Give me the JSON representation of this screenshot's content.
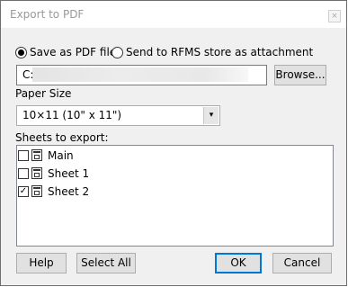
{
  "window": {
    "title": "Export to PDF",
    "close_glyph": "×"
  },
  "export_mode": {
    "options": [
      {
        "label": "Save as PDF file",
        "selected": true
      },
      {
        "label": "Send to RFMS store as attachment",
        "selected": false
      }
    ]
  },
  "path": {
    "value": "C:\\"
  },
  "browse_button": {
    "label": "Browse..."
  },
  "paper_size": {
    "label": "Paper Size",
    "selected": "10×11 (10\" x 11\")",
    "arrow": "▾"
  },
  "sheets": {
    "label": "Sheets to export:",
    "items": [
      {
        "name": "Main",
        "checked": false,
        "check_glyph": ""
      },
      {
        "name": "Sheet 1",
        "checked": false,
        "check_glyph": ""
      },
      {
        "name": "Sheet 2",
        "checked": true,
        "check_glyph": "✓"
      }
    ]
  },
  "buttons": {
    "help": "Help",
    "select_all": "Select All",
    "ok": "OK",
    "cancel": "Cancel"
  },
  "colors": {
    "accent": "#0078d7",
    "dialog_bg": "#f0f0f0",
    "title_text": "#999999"
  }
}
